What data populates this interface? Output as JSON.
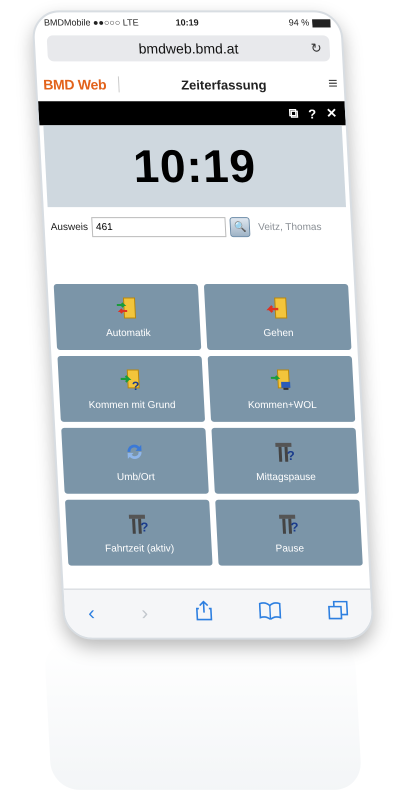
{
  "status": {
    "carrier": "BMDMobile ●●○○○ LTE",
    "time": "10:19",
    "battery": "94 %"
  },
  "browser": {
    "url": "bmdweb.bmd.at",
    "reload_icon": "↻"
  },
  "app": {
    "logo": "BMD Web",
    "title": "Zeiterfassung",
    "menu_icon": "≡"
  },
  "toolbar": {
    "icons": [
      "copy-icon",
      "help-icon",
      "close-icon"
    ]
  },
  "clock": {
    "time": "10:19"
  },
  "ausweis": {
    "label": "Ausweis",
    "value": "461",
    "user": "Veitz, Thomas"
  },
  "tiles": [
    {
      "label": "Automatik",
      "icon": "door-arrow-in-out-icon"
    },
    {
      "label": "Gehen",
      "icon": "door-arrow-out-icon"
    },
    {
      "label": "Kommen mit Grund",
      "icon": "door-arrow-question-icon"
    },
    {
      "label": "Kommen+WOL",
      "icon": "door-computer-icon"
    },
    {
      "label": "Umb/Ort",
      "icon": "swap-arrows-icon"
    },
    {
      "label": "Mittagspause",
      "icon": "pause-question-icon"
    },
    {
      "label": "Fahrtzeit (aktiv)",
      "icon": "pause-question-icon"
    },
    {
      "label": "Pause",
      "icon": "pause-question-icon"
    }
  ],
  "tabbar": {
    "back": "‹",
    "forward": "›",
    "share": "⇪",
    "bookmarks": "📖",
    "tabs": "❐"
  }
}
